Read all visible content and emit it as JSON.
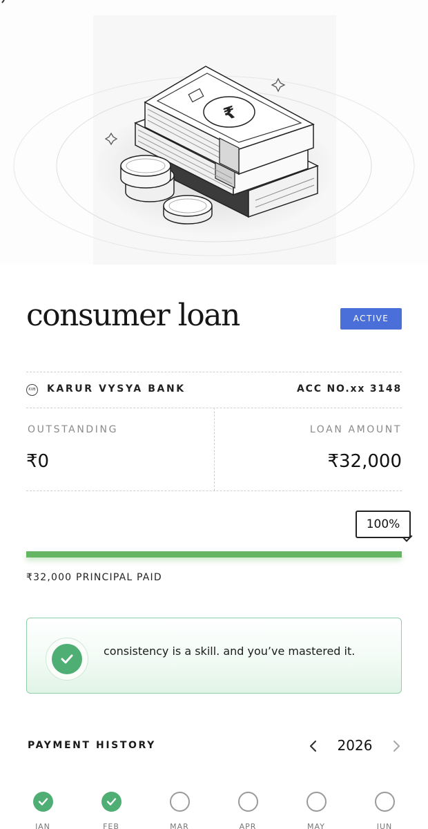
{
  "loan": {
    "title": "consumer loan",
    "status": "ACTIVE",
    "bank_name": "KARUR VYSYA BANK",
    "bank_logo_text": "KVB",
    "account_no": "ACC NO.xx 3148",
    "outstanding_label": "OUTSTANDING",
    "outstanding_value": "₹0",
    "loan_amount_label": "LOAN AMOUNT",
    "loan_amount_value": "₹32,000"
  },
  "progress": {
    "percent_label": "100%",
    "fraction_paid": 1.0,
    "principal_paid_text": "₹32,000 PRINCIPAL PAID"
  },
  "message": {
    "text": "consistency is a skill. and you’ve mastered it."
  },
  "payment_history": {
    "title": "PAYMENT HISTORY",
    "year": "2026",
    "months": [
      {
        "label": "JAN",
        "paid": true
      },
      {
        "label": "FEB",
        "paid": true
      },
      {
        "label": "MAR",
        "paid": false
      },
      {
        "label": "APR",
        "paid": false
      },
      {
        "label": "MAY",
        "paid": false
      },
      {
        "label": "JUN",
        "paid": false
      }
    ]
  },
  "colors": {
    "status_badge": "#4a6fd8",
    "progress_fill": "#64b662",
    "paid_check": "#4fae74",
    "message_border": "#8fcfa7"
  }
}
